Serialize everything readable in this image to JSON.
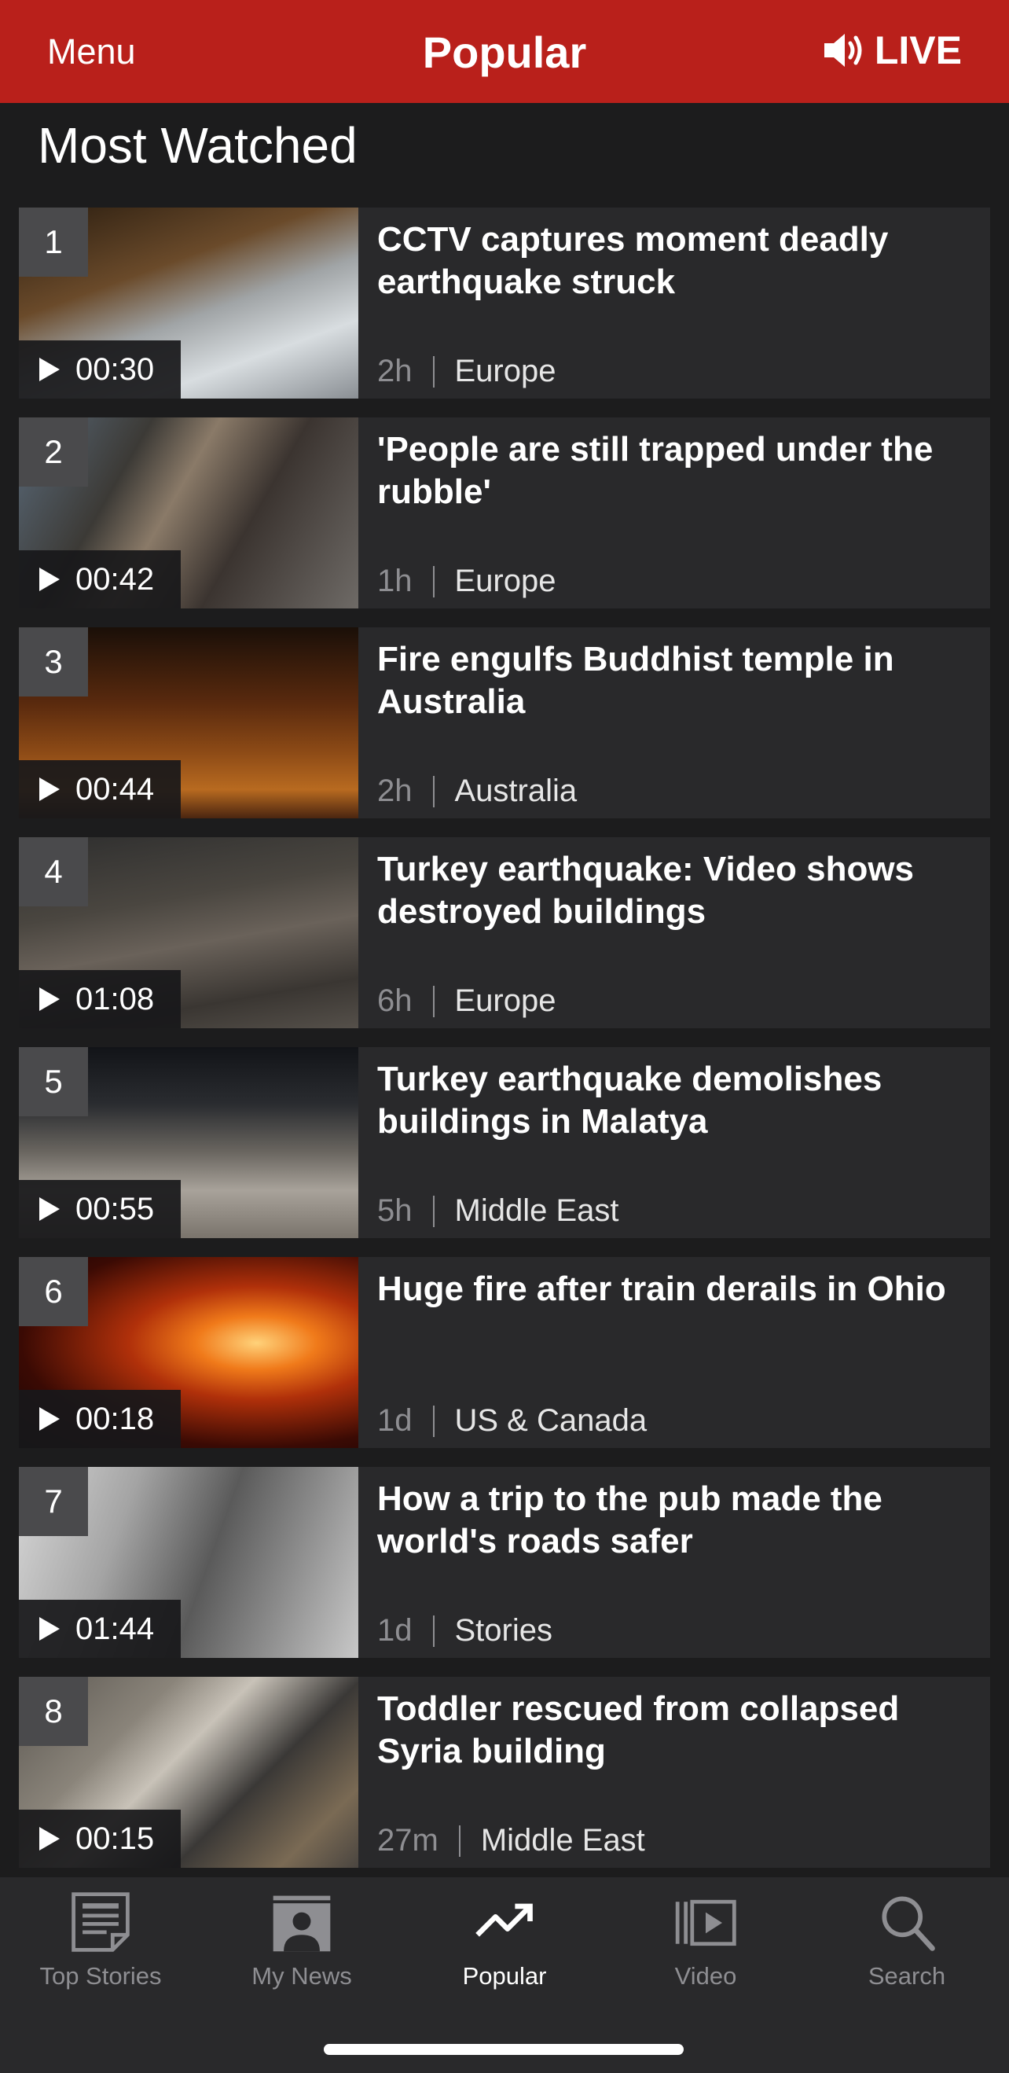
{
  "header": {
    "menu_label": "Menu",
    "title": "Popular",
    "live_label": "LIVE",
    "live_icon": "speaker-icon",
    "color": "#b9201b"
  },
  "section_title": "Most Watched",
  "items": [
    {
      "rank": "1",
      "duration": "00:30",
      "headline": "CCTV captures moment deadly earthquake struck",
      "age": "2h",
      "section": "Europe"
    },
    {
      "rank": "2",
      "duration": "00:42",
      "headline": "'People are still trapped under the rubble'",
      "age": "1h",
      "section": "Europe"
    },
    {
      "rank": "3",
      "duration": "00:44",
      "headline": "Fire engulfs Buddhist temple in Australia",
      "age": "2h",
      "section": "Australia"
    },
    {
      "rank": "4",
      "duration": "01:08",
      "headline": "Turkey earthquake: Video shows destroyed buildings",
      "age": "6h",
      "section": "Europe"
    },
    {
      "rank": "5",
      "duration": "00:55",
      "headline": "Turkey earthquake demolishes buildings in Malatya",
      "age": "5h",
      "section": "Middle East"
    },
    {
      "rank": "6",
      "duration": "00:18",
      "headline": "Huge fire after train derails in Ohio",
      "age": "1d",
      "section": "US & Canada"
    },
    {
      "rank": "7",
      "duration": "01:44",
      "headline": "How a trip to the pub made the world's roads safer",
      "age": "1d",
      "section": "Stories"
    },
    {
      "rank": "8",
      "duration": "00:15",
      "headline": "Toddler rescued from collapsed Syria building",
      "age": "27m",
      "section": "Middle East"
    }
  ],
  "tabs": [
    {
      "label": "Top Stories",
      "icon": "newspaper-icon",
      "active": false
    },
    {
      "label": "My News",
      "icon": "person-icon",
      "active": false
    },
    {
      "label": "Popular",
      "icon": "trending-icon",
      "active": true
    },
    {
      "label": "Video",
      "icon": "video-icon",
      "active": false
    },
    {
      "label": "Search",
      "icon": "search-icon",
      "active": false
    }
  ]
}
